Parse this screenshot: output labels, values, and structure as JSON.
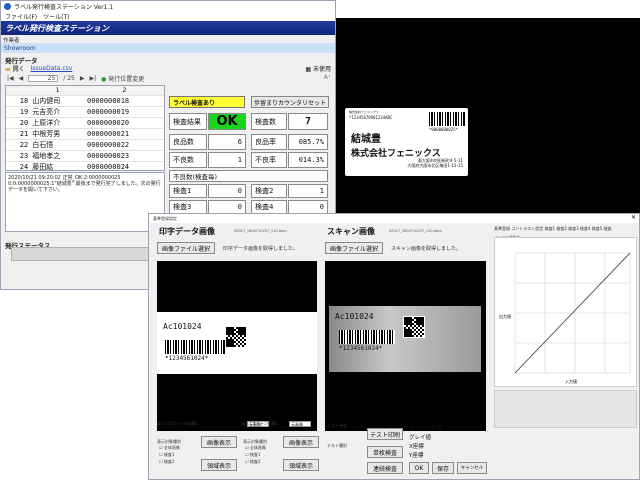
{
  "main_window": {
    "title": "ラベル発行検査ステーション Ver1.1",
    "menu": [
      "ファイル(F)",
      "ツール(T)"
    ],
    "banner": "ラベル発行検査ステーション",
    "user_label": "作業者",
    "user_value": "Showroom",
    "section_issue": "発行データ",
    "open_label": "開く",
    "file_name": "IssueData.csv",
    "unused_label": "未使用",
    "page_current": "25",
    "page_total": "/ 25",
    "change_position_label": "発行位置変更",
    "grid": {
      "headers": [
        "1",
        "2"
      ],
      "rows": [
        {
          "no": "18",
          "name": "山内健司",
          "code": "0000000018",
          "selected": false
        },
        {
          "no": "19",
          "name": "元吉亮介",
          "code": "0000000019",
          "selected": false
        },
        {
          "no": "20",
          "name": "上原洋介",
          "code": "0000000020",
          "selected": false
        },
        {
          "no": "21",
          "name": "中根芳男",
          "code": "0000000021",
          "selected": false
        },
        {
          "no": "22",
          "name": "白石悟",
          "code": "0000000022",
          "selected": false
        },
        {
          "no": "23",
          "name": "福地孝之",
          "code": "0000000023",
          "selected": false
        },
        {
          "no": "24",
          "name": "藤田紘",
          "code": "0000000024",
          "selected": false
        },
        {
          "no": "25",
          "name": "結城豊",
          "code": "0000000025",
          "selected": true
        }
      ]
    },
    "log_text": "2020/10/21 09:20:02 正常_OK:2:0000000025 0:0:0000000025:1\"結城豊\" 最後まで発行完了しました。次の発行データを開いて下さい。",
    "section_status": "発行ステータス",
    "status_text": "完了 IssueD",
    "inspection": {
      "header": "ラベル検査あり",
      "reset_button": "歩留まりカウンタリセット",
      "result_label": "検査結果",
      "result_value": "OK",
      "count_label": "検査数",
      "count_value": "7",
      "good_label": "良品数",
      "good_value": "6",
      "good_rate_label": "良品率",
      "good_rate_value": "085.7%",
      "bad_label": "不良数",
      "bad_value": "1",
      "bad_rate_label": "不良率",
      "bad_rate_value": "014.3%",
      "bad_by_item_label": "不良数(検査毎)",
      "check1_label": "検査1",
      "check1_value": "0",
      "check2_label": "検査2",
      "check2_value": "1",
      "check3_label": "検査3",
      "check3_value": "0",
      "check4_label": "検査4",
      "check4_value": "0"
    },
    "label_preview": {
      "company_small": "株式会社フェニックス",
      "serial": "*12345678901234ABC",
      "barcode_text": "*0000000025*",
      "name": "結城豊",
      "company": "株式会社フェニックス",
      "address_line1": "東大阪市何田新町4-5-11",
      "address_line2": "大阪府大阪市北区梅田1-15-15"
    }
  },
  "settings_window": {
    "title": "基準登録設定",
    "print_title": "印字データ画像",
    "print_file": "00017_1600710257_110.bmp",
    "print_select_button": "画像ファイル選択",
    "print_msg": "印字データ画像を取得しました。",
    "scan_title": "スキャン画像",
    "scan_file": "00017_1600710257_110.bmp",
    "scan_select_button": "画像ファイル選択",
    "scan_msg": "スキャン画像を取得しました。",
    "label_code": "Ac101024",
    "label_barcode": "*1234561024*",
    "print_display_label": "表示 [印字データ画像]",
    "scan_display_label": "表示 [スキャン画像]",
    "original_size": "元画像",
    "image_display_button": "画像表示",
    "area_display_button": "領域表示",
    "display_target_label": "表示対象種別",
    "whole_image": "全体画像",
    "check1": "検査1",
    "check2": "検査2",
    "test_label": "テスト検査",
    "test_print_button": "テスト印刷",
    "single_check_button": "単枚検査",
    "continuous_check_button": "連続検査",
    "test_type_label": "テスト種別",
    "click_image_label": "クリック画像",
    "gray_label": "グレイ値",
    "x_coord_label": "X座標",
    "y_coord_label": "Y座標",
    "ok_button": "OK",
    "save_button": "保存",
    "cancel_button": "キャンセル",
    "graph_tabs": "基準登録  コントラスト設定  検査1  検査2  検査3  検査4  検査5  検査",
    "graph_checkbox": "on/off操作",
    "graph_axis_x": "入力値",
    "graph_axis_y": "出力値"
  }
}
